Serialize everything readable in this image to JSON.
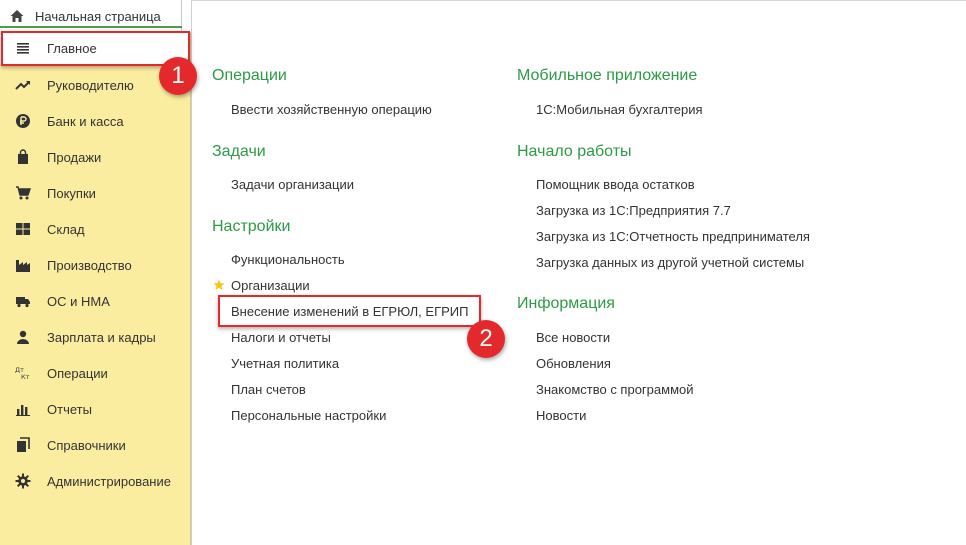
{
  "home_tab": {
    "label": "Начальная страница"
  },
  "sidebar": {
    "items": [
      {
        "label": "Главное",
        "icon": "list-icon"
      },
      {
        "label": "Руководителю",
        "icon": "trend-icon"
      },
      {
        "label": "Банк и касса",
        "icon": "ruble-icon"
      },
      {
        "label": "Продажи",
        "icon": "bag-icon"
      },
      {
        "label": "Покупки",
        "icon": "cart-icon"
      },
      {
        "label": "Склад",
        "icon": "warehouse-icon"
      },
      {
        "label": "Производство",
        "icon": "factory-icon"
      },
      {
        "label": "ОС и НМА",
        "icon": "truck-icon"
      },
      {
        "label": "Зарплата и кадры",
        "icon": "person-icon"
      },
      {
        "label": "Операции",
        "icon": "dt-kt-icon"
      },
      {
        "label": "Отчеты",
        "icon": "bar-chart-icon"
      },
      {
        "label": "Справочники",
        "icon": "books-icon"
      },
      {
        "label": "Администрирование",
        "icon": "gear-icon"
      }
    ],
    "icon_text": {
      "dt": "Дт",
      "kt": "Кт"
    }
  },
  "sections": {
    "operations": {
      "title": "Операции",
      "links": [
        "Ввести хозяйственную операцию"
      ]
    },
    "tasks": {
      "title": "Задачи",
      "links": [
        "Задачи организации"
      ]
    },
    "settings": {
      "title": "Настройки",
      "links": [
        "Функциональность",
        "Организации",
        "Внесение изменений в ЕГРЮЛ, ЕГРИП",
        "Налоги и отчеты",
        "Учетная политика",
        "План счетов",
        "Персональные настройки"
      ]
    },
    "mobile": {
      "title": "Мобильное приложение",
      "links": [
        "1С:Мобильная бухгалтерия"
      ]
    },
    "start": {
      "title": "Начало работы",
      "links": [
        "Помощник ввода остатков",
        "Загрузка из 1С:Предприятия 7.7",
        "Загрузка из 1С:Отчетность предпринимателя",
        "Загрузка данных из другой учетной системы"
      ]
    },
    "info": {
      "title": "Информация",
      "links": [
        "Все новости",
        "Обновления",
        "Знакомство с программой",
        "Новости"
      ]
    }
  },
  "annotations": {
    "badge_1": "1",
    "badge_2": "2"
  },
  "colors": {
    "sidebar_bg": "#fbeda0",
    "section_title": "#2d9a45",
    "annotation_red": "#e3292c",
    "star": "#f5c518"
  }
}
